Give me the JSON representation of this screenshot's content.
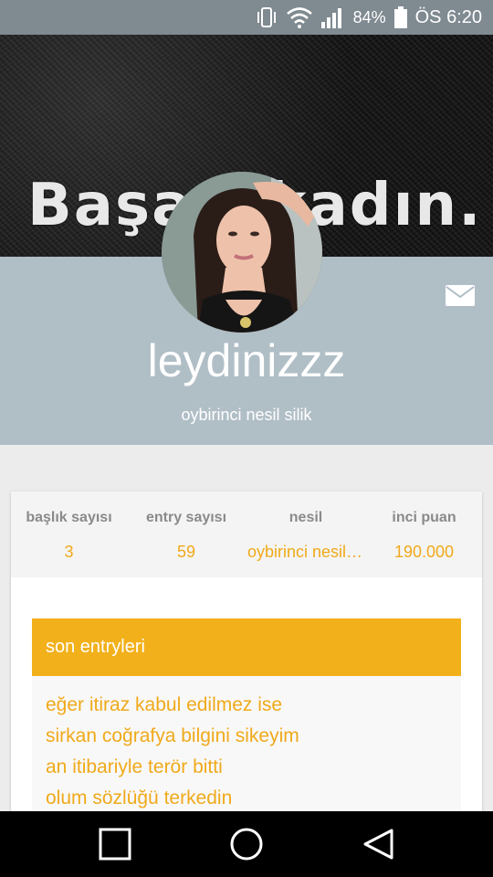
{
  "status_bar": {
    "battery_percent": "84%",
    "time": "ÖS 6:20",
    "icons": [
      "vibrate-icon",
      "wifi-icon",
      "signal-icon",
      "battery-icon"
    ]
  },
  "cover": {
    "text": "Başarı kadın."
  },
  "profile": {
    "username": "leydinizzz",
    "subtitle": "oybirinci nesil silik",
    "mail_icon": "mail-icon"
  },
  "stats": [
    {
      "label": "başlık sayısı",
      "value": "3"
    },
    {
      "label": "entry sayısı",
      "value": "59"
    },
    {
      "label": "nesil",
      "value": "oybirinci nesil silik"
    },
    {
      "label": "inci puan",
      "value": "190.000"
    }
  ],
  "recent_entries": {
    "title": "son entryleri",
    "items": [
      "eğer itiraz kabul edilmez ise",
      "sirkan coğrafya bilgini sikeyim",
      "an itibariyle terör bitti",
      "olum sözlüğü terkedin"
    ]
  },
  "colors": {
    "accent": "#f2b01a",
    "profile_bg": "#b0bec6",
    "status_bar_bg": "#7f8a91"
  },
  "nav": {
    "icons": [
      "recents-icon",
      "home-icon",
      "back-icon"
    ]
  }
}
